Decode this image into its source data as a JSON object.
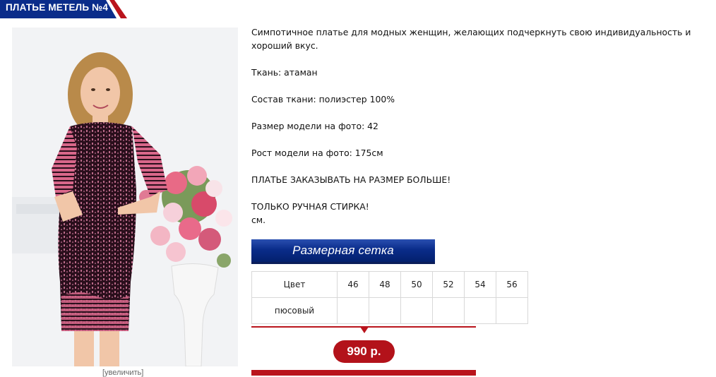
{
  "product": {
    "title": "ПЛАТЬЕ МЕТЕЛЬ №4",
    "enlarge_link": "[увеличить]",
    "description": [
      "Симпотичное платье  для модных женщин, желающих подчеркнуть свою индивидуальность и хороший вкус.",
      "Ткань: атаман",
      "Состав ткани: полиэстер 100%",
      "Размер модели на фото: 42",
      "Рост модели на фото: 175см",
      "ПЛАТЬЕ ЗАКАЗЫВАТЬ НА РАЗМЕР БОЛЬШЕ!",
      "ТОЛЬКО РУЧНАЯ СТИРКА!",
      "см."
    ],
    "size_grid_label": "Размерная сетка",
    "size_table": {
      "header": [
        "Цвет",
        "46",
        "48",
        "50",
        "52",
        "54",
        "56"
      ],
      "rows": [
        [
          "пюсовый",
          "",
          "",
          "",
          "",
          "",
          ""
        ]
      ]
    },
    "price": "990 р."
  },
  "colors": {
    "brand_blue": "#0a2c8a",
    "accent_red": "#b9141c",
    "dress_dark": "#2a0f1c",
    "dress_pink": "#d8678a"
  },
  "icons": {
    "price_pointer": "triangle-down-icon"
  }
}
